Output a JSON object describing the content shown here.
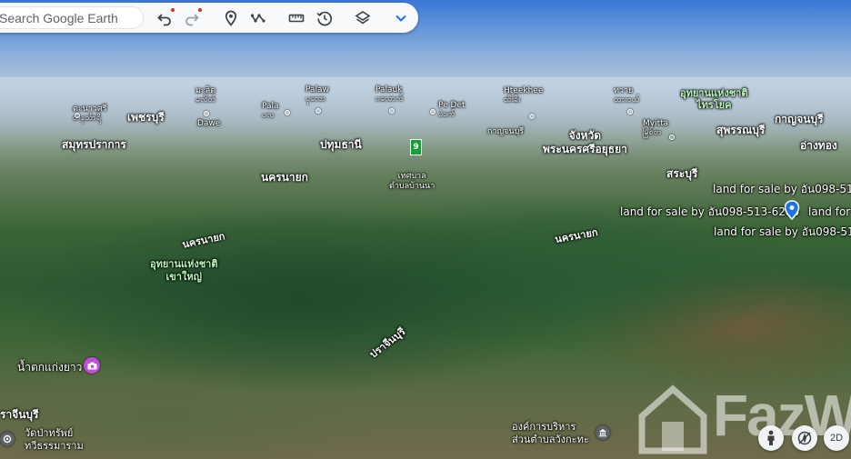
{
  "toolbar": {
    "search_placeholder": "Search Google Earth",
    "icons": [
      "undo-icon",
      "redo-icon",
      "place-pin-icon",
      "path-icon",
      "measure-icon",
      "history-icon",
      "layers-icon",
      "chevron-down-icon"
    ]
  },
  "labels": {
    "samut_prakan": "สมุทรปราการ",
    "phet": "เพชรบุรี",
    "tale": "ตะนาวศรี\nတနင်္သာရီ",
    "mali": "มะลิด\nမလိတ်",
    "dawe": "Dawe",
    "pala": "Pala\nပလ",
    "palaw": "Palaw\nပုလော",
    "palauk": "Palauk\nပလောက်",
    "pedet": "Pe Det\nပဲဒက်",
    "hteekhee": "Hteekhee\nထီးခီး",
    "kanchanaburi_small": "กาญจนบุรี",
    "thawai": "ทวาย\nထားဝယ်",
    "park_saiyok": "อุทยานแห่งชาติ\nไทรโยค",
    "kanchanaburi": "กาญจนบุรี",
    "myitta": "Myitta\nမြစ်တ",
    "suphanburi": "สุพรรณบุรี",
    "angthong": "อ่างทอง",
    "pathumthani": "ปทุมธานี",
    "changwat": "จังหวัด\nพระนครศรีอยุธยา",
    "saraburi": "สระบุรี",
    "nakhonnayok1": "นครนายก",
    "thetsaban": "เทศบาล\nตำบลบ้านนา",
    "badge_number": "9",
    "land1": "land for sale by อัน098-513-6286",
    "land2": "land for sale by อัน098-513-6286",
    "land3": "land for sale by อัน098-513-6286",
    "land4": "land for sale by อัน098-513-6286",
    "nakhonnayok2": "นครนายก",
    "nakhonnayok3": "นครนายก",
    "park_khaoyai": "อุทยานแห่งชาติ\nเขาใหญ่",
    "prachinburi": "ปราจีนบุรี",
    "waterfall": "น้ำตกแก่งยาว",
    "prachinburi_left": "ราจีนบุรี",
    "wat": "วัดป่าทรัพย์\nทวีธรรมาราม",
    "org": "องค์การบริหาร\nส่วนตำบลวังกะทะ"
  },
  "controls": {
    "street_view": "person-icon",
    "compass": "compass-icon",
    "view_mode": "2D"
  },
  "watermark": "FazW"
}
